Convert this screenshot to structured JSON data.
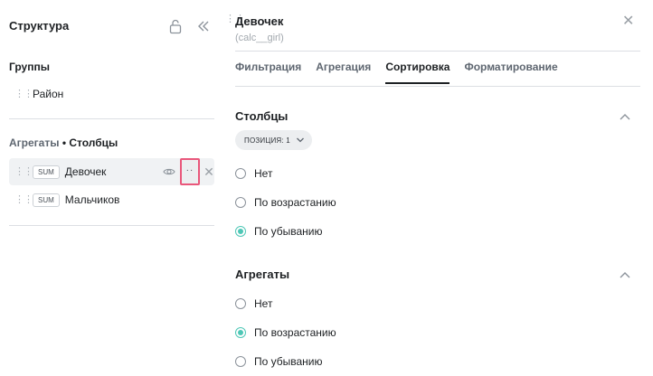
{
  "sidebar": {
    "title": "Структура",
    "groups_label": "Группы",
    "groups": [
      {
        "label": "Район"
      }
    ],
    "aggregates_label": "Агрегаты",
    "aggregates_sep": "•",
    "columns_label": "Столбцы",
    "aggregates": [
      {
        "badge": "SUM",
        "label": "Девочек",
        "menu": "··",
        "remove": "✕"
      },
      {
        "badge": "SUM",
        "label": "Мальчиков"
      }
    ]
  },
  "panel": {
    "title": "Девочек",
    "subtitle": "(calc__girl)",
    "close": "✕",
    "tabs": [
      {
        "label": "Фильтрация"
      },
      {
        "label": "Агрегация"
      },
      {
        "label": "Сортировка"
      },
      {
        "label": "Форматирование"
      }
    ],
    "active_tab": "Сортировка",
    "columns_section": {
      "title": "Столбцы",
      "position_pill": "ПОЗИЦИЯ: 1",
      "options": [
        {
          "label": "Нет",
          "checked": false
        },
        {
          "label": "По возрастанию",
          "checked": false
        },
        {
          "label": "По убыванию",
          "checked": true
        }
      ]
    },
    "aggregates_section": {
      "title": "Агрегаты",
      "options": [
        {
          "label": "Нет",
          "checked": false
        },
        {
          "label": "По возрастанию",
          "checked": true
        },
        {
          "label": "По убыванию",
          "checked": false
        }
      ]
    }
  },
  "colors": {
    "accent_radio": "#4ec7b6",
    "highlight_border": "#e9577b"
  }
}
